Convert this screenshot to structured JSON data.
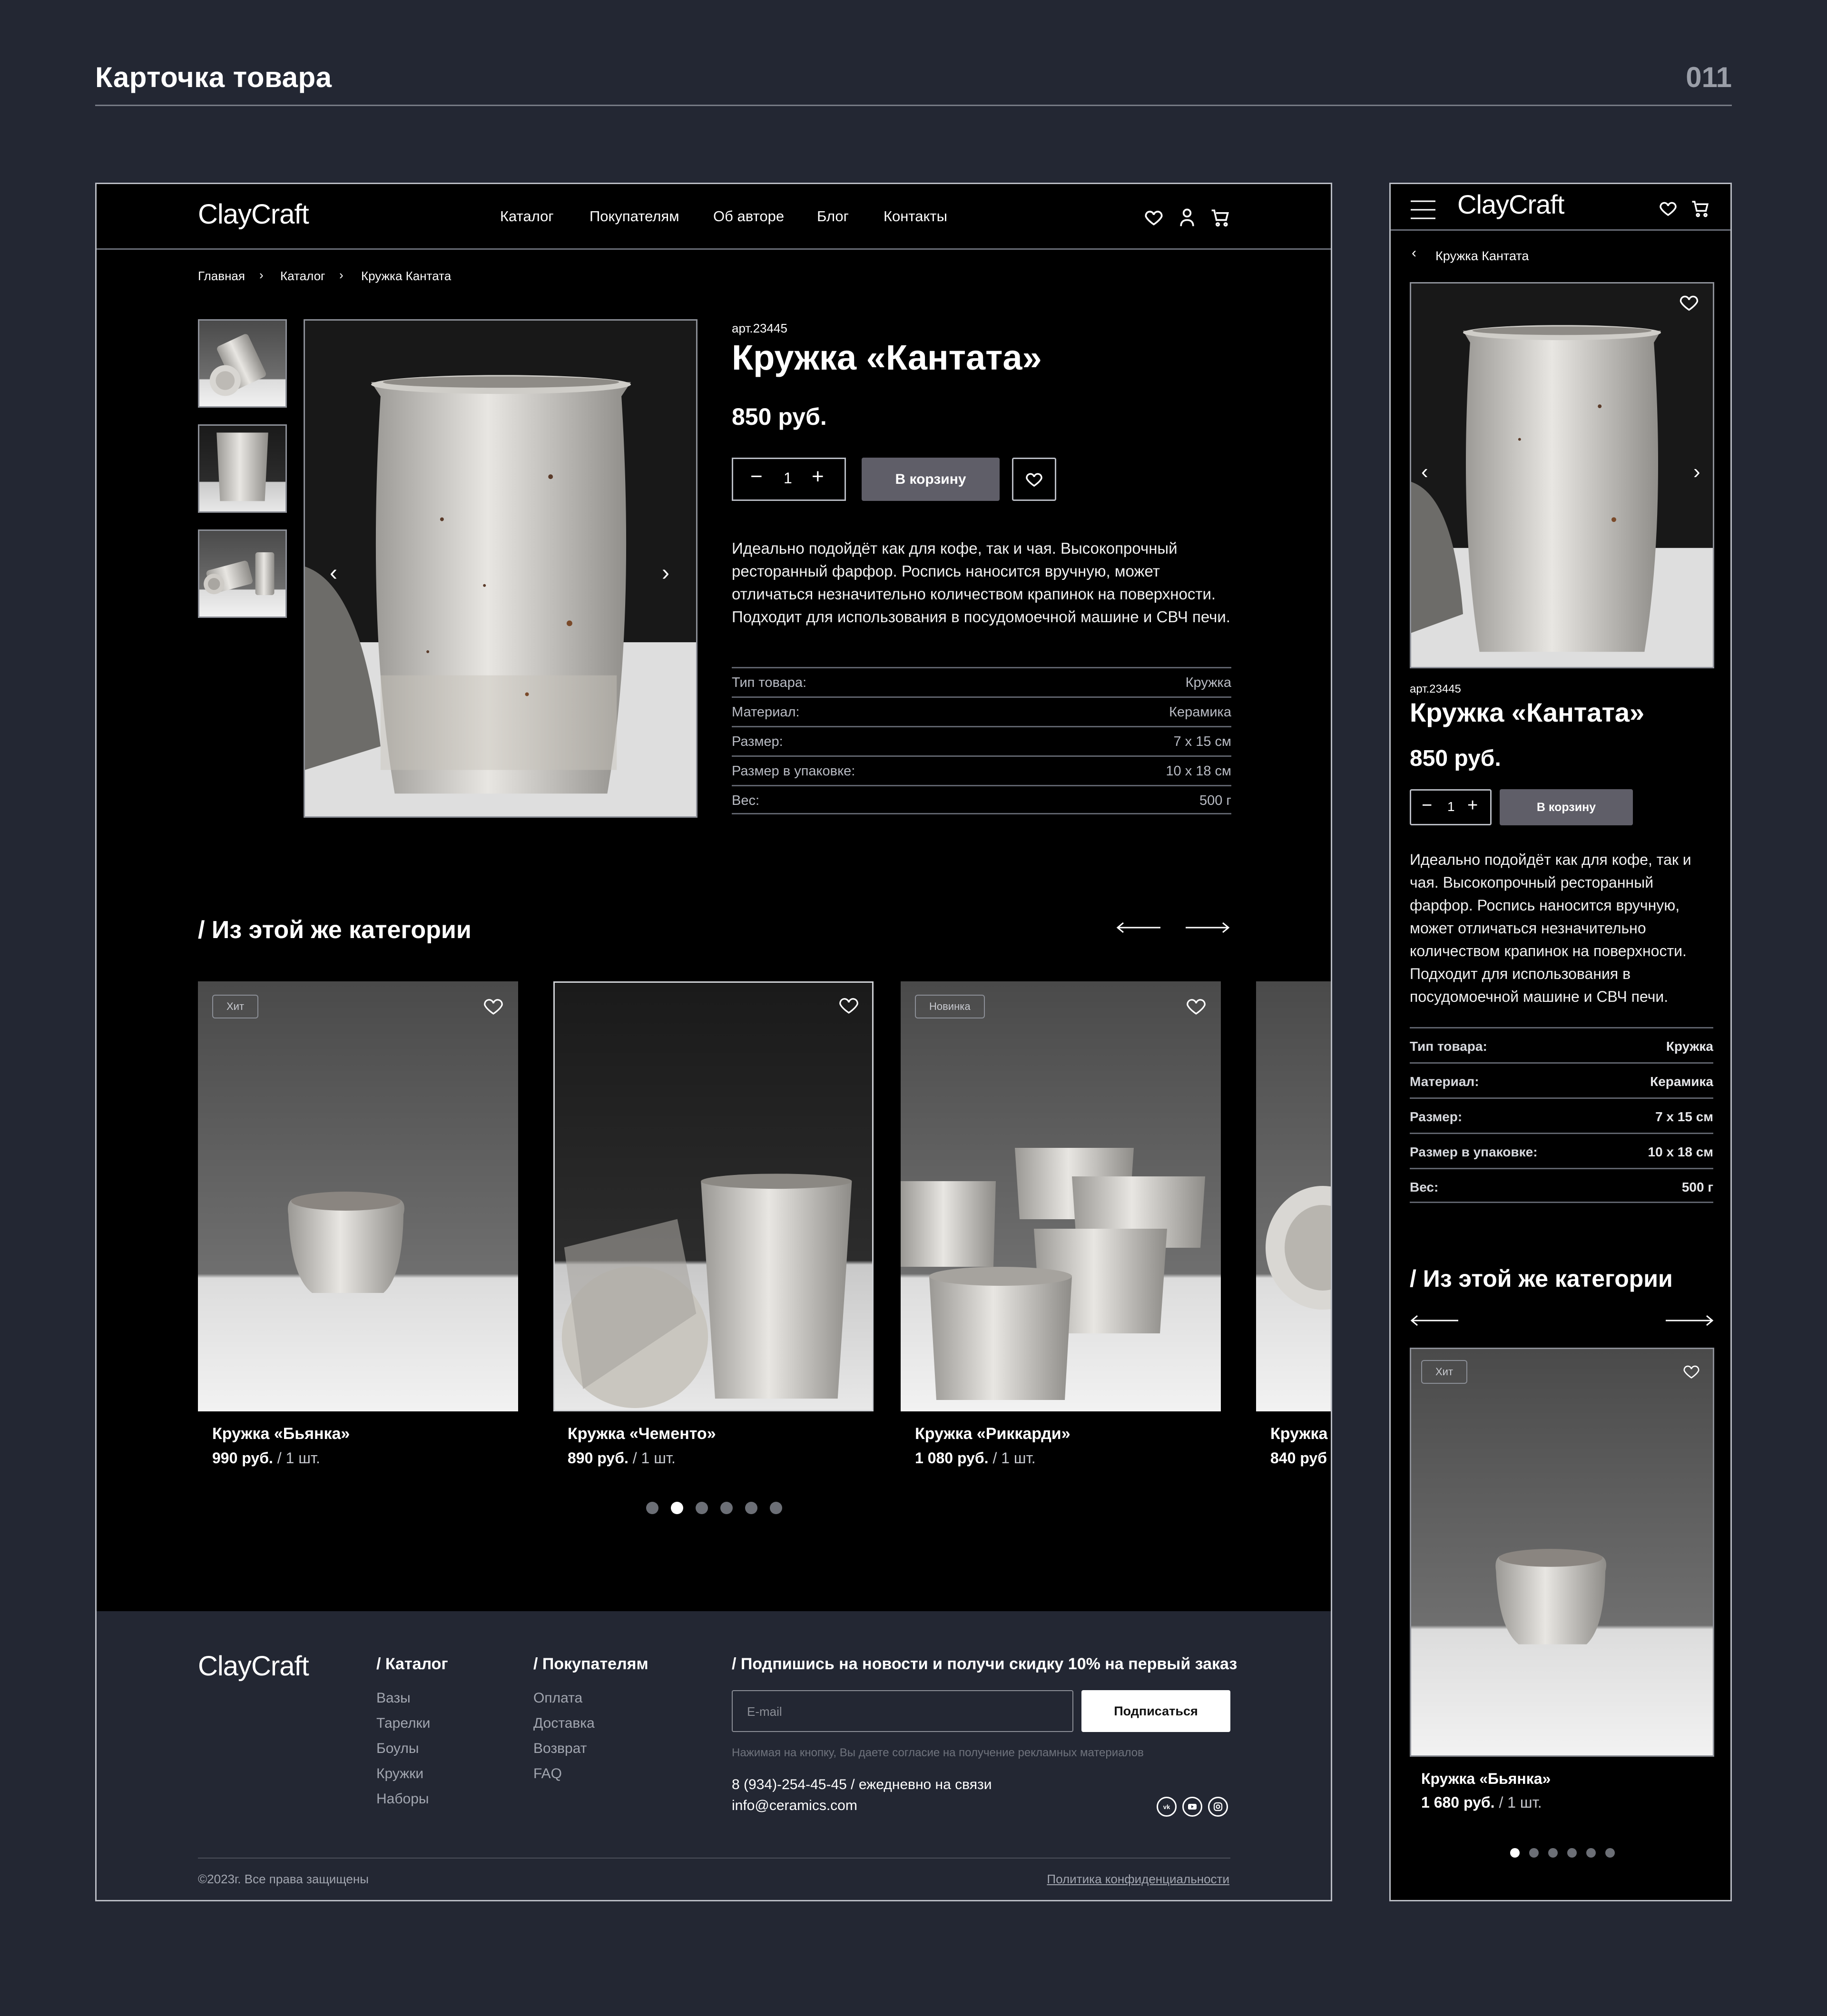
{
  "page": {
    "title": "Карточка товара",
    "number": "011"
  },
  "brand": "ClayCraft",
  "nav": {
    "items": [
      "Каталог",
      "Покупателям",
      "Об авторе",
      "Блог",
      "Контакты"
    ]
  },
  "breadcrumb": {
    "home": "Главная",
    "catalog": "Каталог",
    "current": "Кружка Кантата"
  },
  "product": {
    "sku": "арт.23445",
    "name": "Кружка «Кантата»",
    "price": "850 руб.",
    "quantity": "1",
    "cart_label": "В корзину",
    "description": "Идеально подойдёт как для кофе, так и чая. Высокопрочный ресторанный фарфор. Роспись наносится вручную, может отличаться незначительно количеством крапинок на поверхности. Подходит для использования в посудомоечной машине и СВЧ печи.",
    "specs": [
      {
        "key": "Тип товара:",
        "value": "Кружка"
      },
      {
        "key": "Материал:",
        "value": "Керамика"
      },
      {
        "key": "Размер:",
        "value": "7 х 15 см"
      },
      {
        "key": "Размер в упаковке:",
        "value": "10 х 18 см"
      },
      {
        "key": "Вес:",
        "value": "500 г"
      }
    ]
  },
  "related": {
    "title": "/ Из этой же категории",
    "cards": [
      {
        "badge": "Хит",
        "name": "Кружка «Бьянка»",
        "price": "990 руб.",
        "unit": "/ 1 шт."
      },
      {
        "badge": "",
        "name": "Кружка «Чементо»",
        "price": "890 руб.",
        "unit": "/ 1 шт."
      },
      {
        "badge": "Новинка",
        "name": "Кружка «Риккарди»",
        "price": "1 080 руб.",
        "unit": "/ 1 шт."
      },
      {
        "badge": "",
        "name": "Кружка",
        "price": "840 руб",
        "unit": ""
      }
    ],
    "active_dot": 2,
    "dot_count": 6
  },
  "footer": {
    "catalog_title": "/ Каталог",
    "catalog_links": [
      "Вазы",
      "Тарелки",
      "Боулы",
      "Кружки",
      "Наборы"
    ],
    "buyers_title": "/ Покупателям",
    "buyers_links": [
      "Оплата",
      "Доставка",
      "Возврат",
      "FAQ"
    ],
    "subscribe_title": "/ Подпишись на новости и получи скидку 10% на первый заказ",
    "email_placeholder": "E-mail",
    "subscribe_button": "Подписаться",
    "consent": "Нажимая на кнопку, Вы даете согласие на получение рекламных материалов",
    "phone": "8 (934)-254-45-45 / ежедневно на связи",
    "email": "info@ceramics.com",
    "copyright": "©2023г. Все права защищены",
    "privacy": "Политика конфиденциальности"
  },
  "mobile": {
    "breadcrumb": "Кружка Кантата",
    "description": "Идеально подойдёт как для кофе, так и чая. Высокопрочный ресторанный фарфор. Роспись наносится вручную, может отличаться незначительно количеством крапинок на поверхности. Подходит для использования в посудомоечной машине и СВЧ печи.",
    "card": {
      "badge": "Хит",
      "name": "Кружка «Бьянка»",
      "price": "1 680 руб.",
      "unit": "/ 1 шт."
    },
    "active_dot": 1,
    "dot_count": 6
  },
  "colors": {
    "bg": "#232733",
    "panel": "#000000",
    "cart_button": "#5f5e68",
    "accent_text": "#ffffff"
  }
}
